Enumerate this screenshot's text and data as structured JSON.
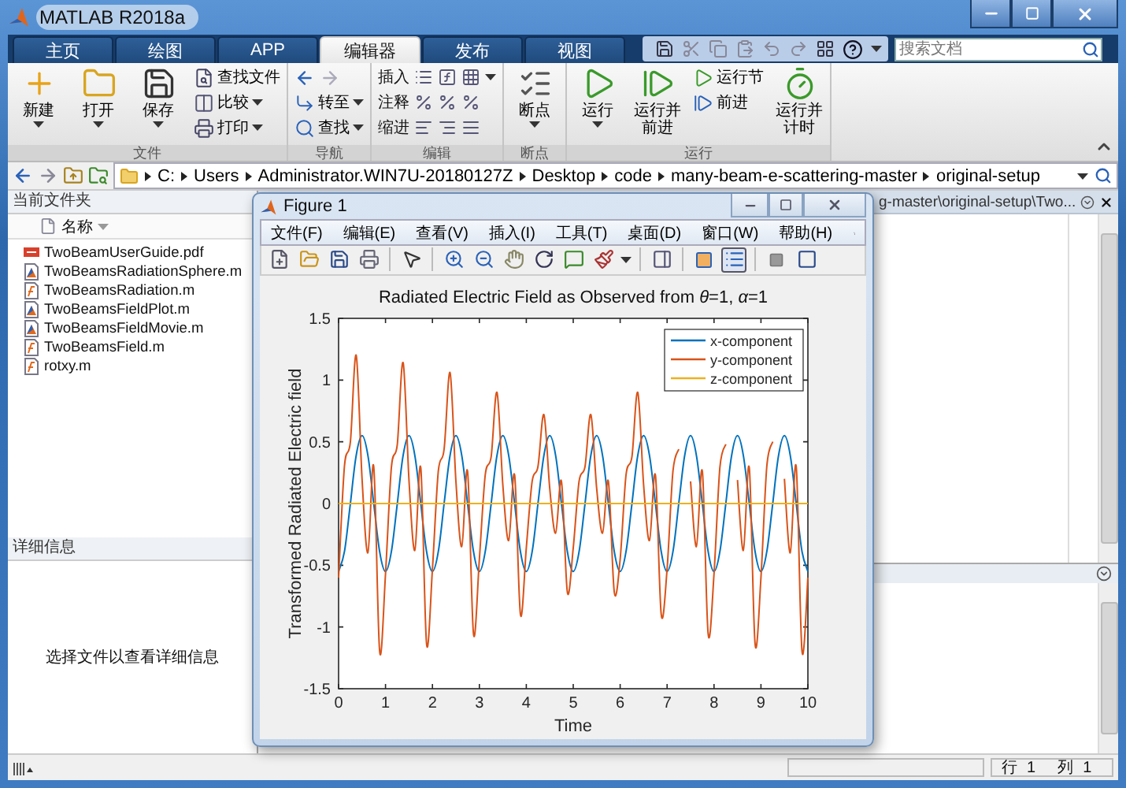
{
  "window": {
    "title": "MATLAB R2018a"
  },
  "tabs": [
    {
      "label": "主页",
      "selected": false
    },
    {
      "label": "绘图",
      "selected": false
    },
    {
      "label": "APP",
      "selected": false
    },
    {
      "label": "编辑器",
      "selected": true
    },
    {
      "label": "发布",
      "selected": false
    },
    {
      "label": "视图",
      "selected": false
    }
  ],
  "search": {
    "placeholder": "搜索文档"
  },
  "ribbon": {
    "groups": [
      {
        "label": "文件",
        "items": [
          {
            "kind": "large",
            "label": "新建",
            "dropdown": true
          },
          {
            "kind": "large",
            "label": "打开",
            "dropdown": true
          },
          {
            "kind": "large",
            "label": "保存",
            "dropdown": true
          },
          {
            "kind": "small",
            "label": "查找文件",
            "dropdown": false
          },
          {
            "kind": "small",
            "label": "比较",
            "dropdown": true
          },
          {
            "kind": "small",
            "label": "打印",
            "dropdown": true
          }
        ]
      },
      {
        "label": "导航",
        "items": [
          {
            "kind": "history"
          },
          {
            "kind": "small",
            "label": "转至",
            "dropdown": true
          },
          {
            "kind": "small",
            "label": "查找",
            "dropdown": true
          }
        ]
      },
      {
        "label": "编辑",
        "items": [
          {
            "kind": "row",
            "label": "插入",
            "dropdown": true
          },
          {
            "kind": "row",
            "label": "注释",
            "dropdown": false
          },
          {
            "kind": "row",
            "label": "缩进",
            "dropdown": false
          }
        ]
      },
      {
        "label": "断点",
        "items": [
          {
            "kind": "large",
            "label": "断点",
            "dropdown": true
          }
        ]
      },
      {
        "label": "运行",
        "items": [
          {
            "kind": "large",
            "label": "运行",
            "dropdown": true
          },
          {
            "kind": "large",
            "label": "运行并前进",
            "dropdown": false
          },
          {
            "kind": "small",
            "label": "运行节",
            "dropdown": false
          },
          {
            "kind": "small",
            "label": "前进",
            "dropdown": false
          },
          {
            "kind": "large",
            "label": "运行并计时",
            "dropdown": false
          }
        ]
      }
    ]
  },
  "address_bar": {
    "segments": [
      "C:",
      "Users",
      "Administrator.WIN7U-20180127Z",
      "Desktop",
      "code",
      "many-beam-e-scattering-master",
      "original-setup"
    ]
  },
  "current_folder": {
    "title": "当前文件夹",
    "column": "名称",
    "files": [
      {
        "name": "TwoBeamUserGuide.pdf",
        "kind": "pdf"
      },
      {
        "name": "TwoBeamsRadiationSphere.m",
        "kind": "script"
      },
      {
        "name": "TwoBeamsRadiation.m",
        "kind": "function"
      },
      {
        "name": "TwoBeamsFieldPlot.m",
        "kind": "script"
      },
      {
        "name": "TwoBeamsFieldMovie.m",
        "kind": "script"
      },
      {
        "name": "TwoBeamsField.m",
        "kind": "function"
      },
      {
        "name": "rotxy.m",
        "kind": "function"
      }
    ]
  },
  "details": {
    "title": "详细信息",
    "message": "选择文件以查看详细信息"
  },
  "editor": {
    "tab_title": "g-master\\original-setup\\Two..."
  },
  "figure": {
    "title": "Figure 1",
    "menu": [
      "文件(F)",
      "编辑(E)",
      "查看(V)",
      "插入(I)",
      "工具(T)",
      "桌面(D)",
      "窗口(W)",
      "帮助(H)"
    ],
    "legend_button": {
      "pressed": true
    },
    "chart_data": {
      "type": "line",
      "title": "Radiated Electric Field as Observed from *θ*=1, *α*=1",
      "xlabel": "Time",
      "ylabel": "Transformed Radiated Electric field",
      "x": [
        0,
        0.125,
        0.25,
        0.375,
        0.5,
        0.625,
        0.75,
        0.875,
        1,
        1.125,
        1.25,
        1.375,
        1.5,
        1.625,
        1.75,
        1.875,
        2,
        2.125,
        2.25,
        2.375,
        2.5,
        2.625,
        2.75,
        2.875,
        3,
        3.125,
        3.25,
        3.375,
        3.5,
        3.625,
        3.75,
        3.875,
        4,
        4.125,
        4.25,
        4.375,
        4.5,
        4.625,
        4.75,
        4.875,
        5,
        5.125,
        5.25,
        5.375,
        5.5,
        5.625,
        5.75,
        5.875,
        6,
        6.125,
        6.25,
        6.375,
        6.5,
        6.625,
        6.75,
        6.875,
        7,
        7.125,
        7.25,
        7.375,
        7.5,
        7.625,
        7.75,
        7.875,
        8,
        8.125,
        8.25,
        8.375,
        8.5,
        8.625,
        8.75,
        8.875,
        9,
        9.125,
        9.25,
        9.375,
        9.5,
        9.625,
        9.75,
        9.875,
        10
      ],
      "series": [
        {
          "name": "x-component",
          "color": "#0072bd",
          "values": [
            -0.55,
            -0.39,
            0,
            0.39,
            0.55,
            0.39,
            0,
            -0.39,
            -0.55,
            -0.39,
            0,
            0.39,
            0.55,
            0.39,
            0,
            -0.39,
            -0.55,
            -0.39,
            0,
            0.39,
            0.55,
            0.39,
            0,
            -0.39,
            -0.55,
            -0.39,
            0,
            0.39,
            0.55,
            0.39,
            0,
            -0.39,
            -0.55,
            -0.39,
            0,
            0.39,
            0.55,
            0.39,
            0,
            -0.39,
            -0.55,
            -0.39,
            0,
            0.39,
            0.55,
            0.39,
            0,
            -0.39,
            -0.55,
            -0.39,
            0,
            0.39,
            0.55,
            0.39,
            0,
            -0.39,
            -0.55,
            -0.39,
            0,
            0.39,
            0.55,
            0.39,
            0,
            -0.39,
            -0.55,
            -0.39,
            0,
            0.39,
            0.55,
            0.39,
            0,
            -0.39,
            -0.55,
            -0.39,
            0,
            0.39,
            0.55,
            0.39,
            0,
            -0.39,
            -0.55
          ]
        },
        {
          "name": "y-component",
          "color": "#d95319",
          "values": [
            -0.6,
            0.3,
            0.5,
            1.2,
            0.2,
            -0.4,
            0.3,
            -1.2,
            -0.57,
            0.29,
            0.48,
            1.14,
            0.19,
            -0.38,
            0.29,
            -1.14,
            -0.53,
            0.26,
            0.44,
            1.06,
            0.18,
            -0.35,
            0.26,
            -1.06,
            -0.45,
            0.23,
            0.38,
            0.9,
            0.15,
            -0.3,
            0.23,
            -0.9,
            -0.36,
            0.18,
            0.3,
            0.72,
            0.12,
            -0.24,
            0.18,
            -0.72,
            -0.36,
            0.18,
            0.3,
            0.72,
            0.12,
            -0.24,
            0.18,
            -0.72,
            -0.45,
            0.23,
            0.38,
            0.9,
            0.15,
            -0.3,
            0.23,
            -0.9,
            -0.53,
            0.26,
            0.44,
            null,
            0.18,
            -0.35,
            0.26,
            -1.06,
            -0.57,
            0.29,
            0.48,
            null,
            0.19,
            -0.38,
            0.29,
            -1.14,
            -0.6,
            0.3,
            0.5,
            null,
            0.2,
            -0.4,
            0.3,
            -1.2,
            -0.6
          ]
        },
        {
          "name": "z-component",
          "color": "#edb120",
          "values": [
            0,
            0,
            0,
            0,
            0,
            0,
            0,
            0,
            0,
            0,
            0,
            0,
            0,
            0,
            0,
            0,
            0,
            0,
            0,
            0,
            0,
            0,
            0,
            0,
            0,
            0,
            0,
            0,
            0,
            0,
            0,
            0,
            0,
            0,
            0,
            0,
            0,
            0,
            0,
            0,
            0,
            0,
            0,
            0,
            0,
            0,
            0,
            0,
            0,
            0,
            0,
            0,
            0,
            0,
            0,
            0,
            0,
            0,
            0,
            0,
            0,
            0,
            0,
            0,
            0,
            0,
            0,
            0,
            0,
            0,
            0,
            0,
            0,
            0,
            0,
            0,
            0,
            0,
            0,
            0,
            0
          ]
        }
      ],
      "legend": "top right",
      "xlim": [
        0,
        10
      ],
      "ylim": [
        -1.5,
        1.5
      ],
      "xticks": [
        0,
        1,
        2,
        3,
        4,
        5,
        6,
        7,
        8,
        9,
        10
      ],
      "yticks": [
        -1.5,
        -1,
        -0.5,
        0,
        0.5,
        1,
        1.5
      ]
    }
  },
  "status_bar": {
    "row_label": "行",
    "row": "1",
    "col_label": "列",
    "col": "1"
  }
}
